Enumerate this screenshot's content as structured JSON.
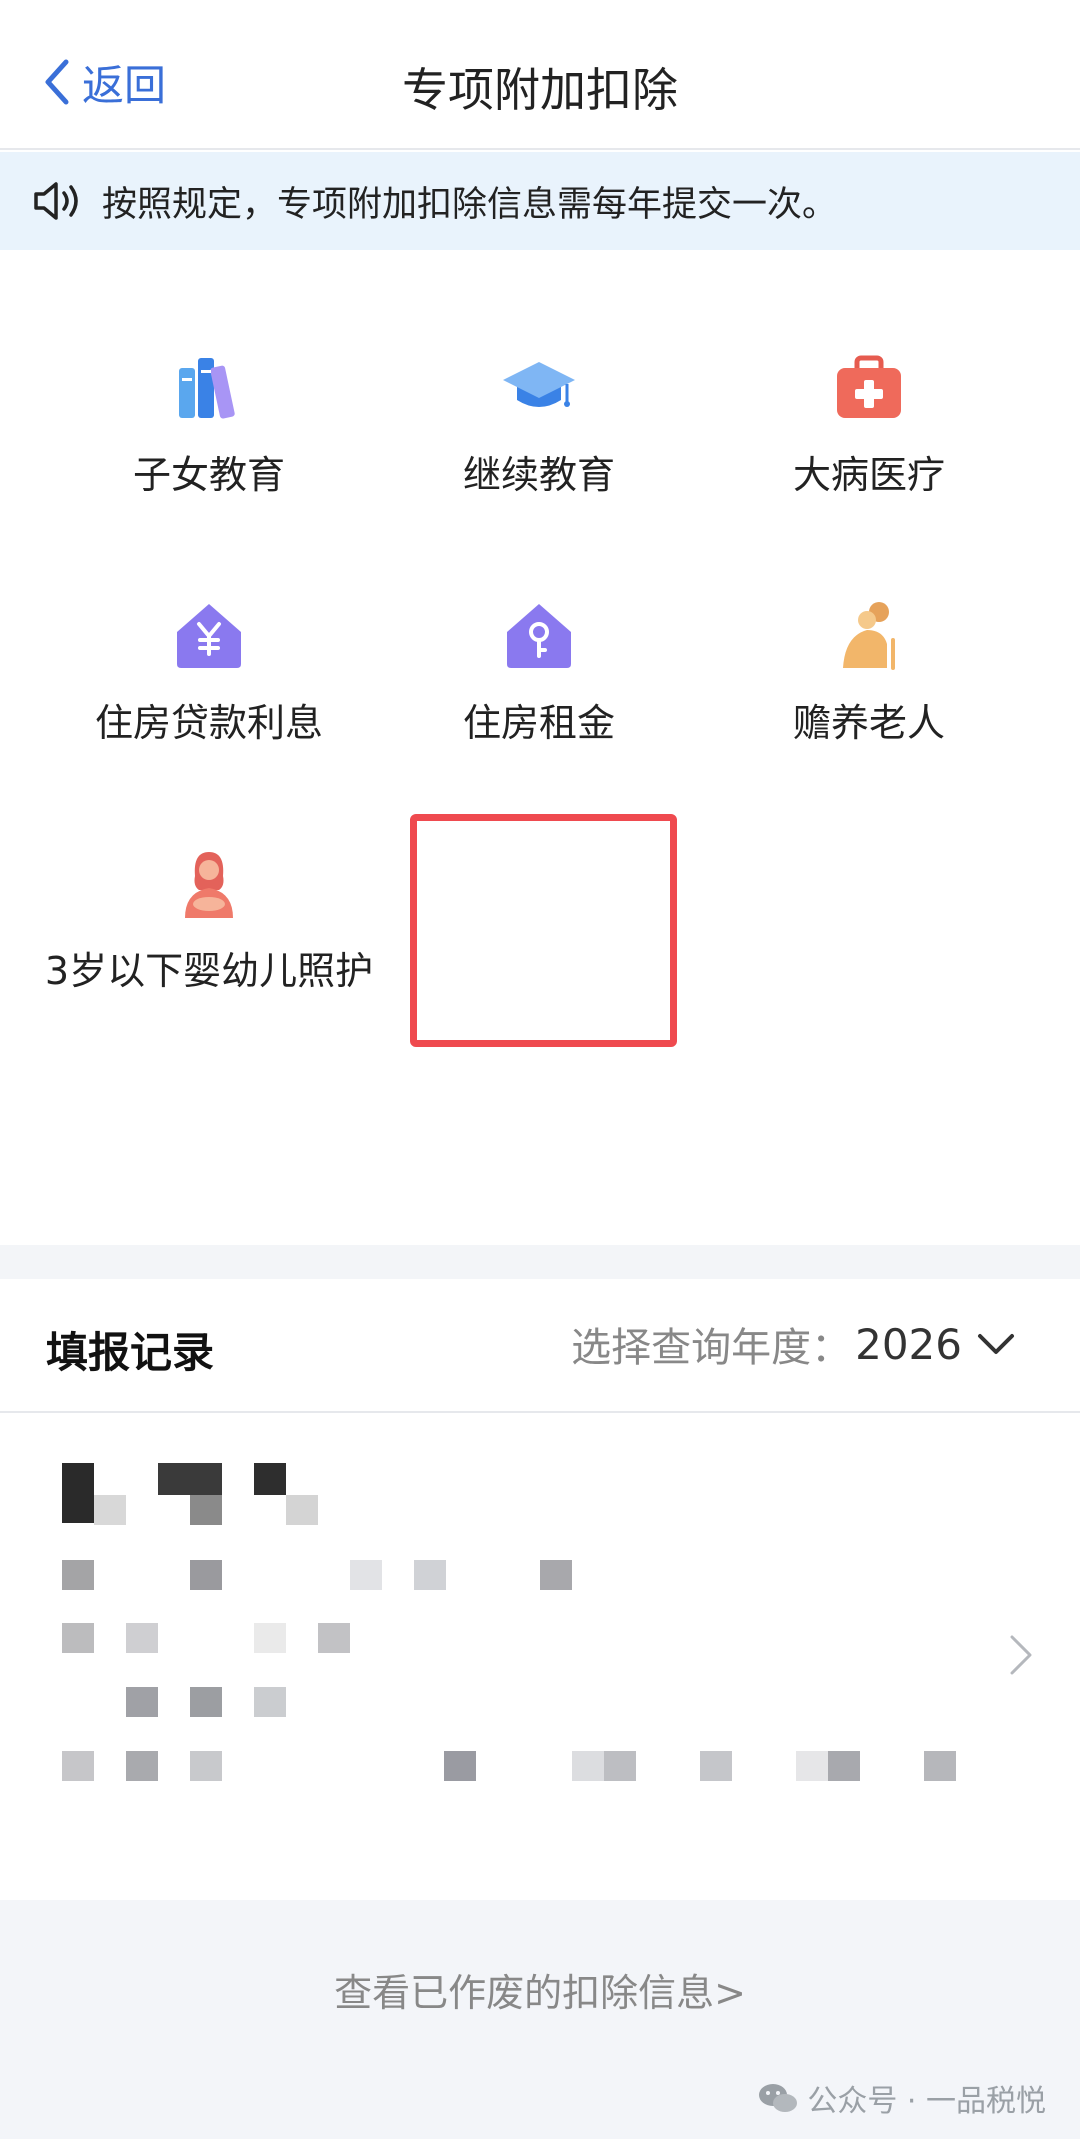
{
  "nav": {
    "back_label": "返回",
    "title": "专项附加扣除"
  },
  "notice": {
    "text": "按照规定，专项附加扣除信息需每年提交一次。"
  },
  "categories": [
    {
      "label": "子女教育",
      "icon": "books-icon"
    },
    {
      "label": "继续教育",
      "icon": "graduation-cap-icon"
    },
    {
      "label": "大病医疗",
      "icon": "medical-kit-icon"
    },
    {
      "label": "住房贷款利息",
      "icon": "house-yen-icon"
    },
    {
      "label": "住房租金",
      "icon": "house-key-icon",
      "highlighted": true
    },
    {
      "label": "赡养老人",
      "icon": "elderly-person-icon"
    },
    {
      "label": "3岁以下婴幼儿照护",
      "icon": "mother-baby-icon"
    }
  ],
  "records": {
    "title": "填报记录",
    "year_label": "选择查询年度：",
    "year_value": "2026"
  },
  "footer": {
    "void_link": "查看已作废的扣除信息>",
    "watermark": "公众号 · 一品税悦"
  },
  "colors": {
    "accent": "#3a6fd8",
    "highlight": "#ef4a4f",
    "notice_bg": "#e9f3fc"
  }
}
